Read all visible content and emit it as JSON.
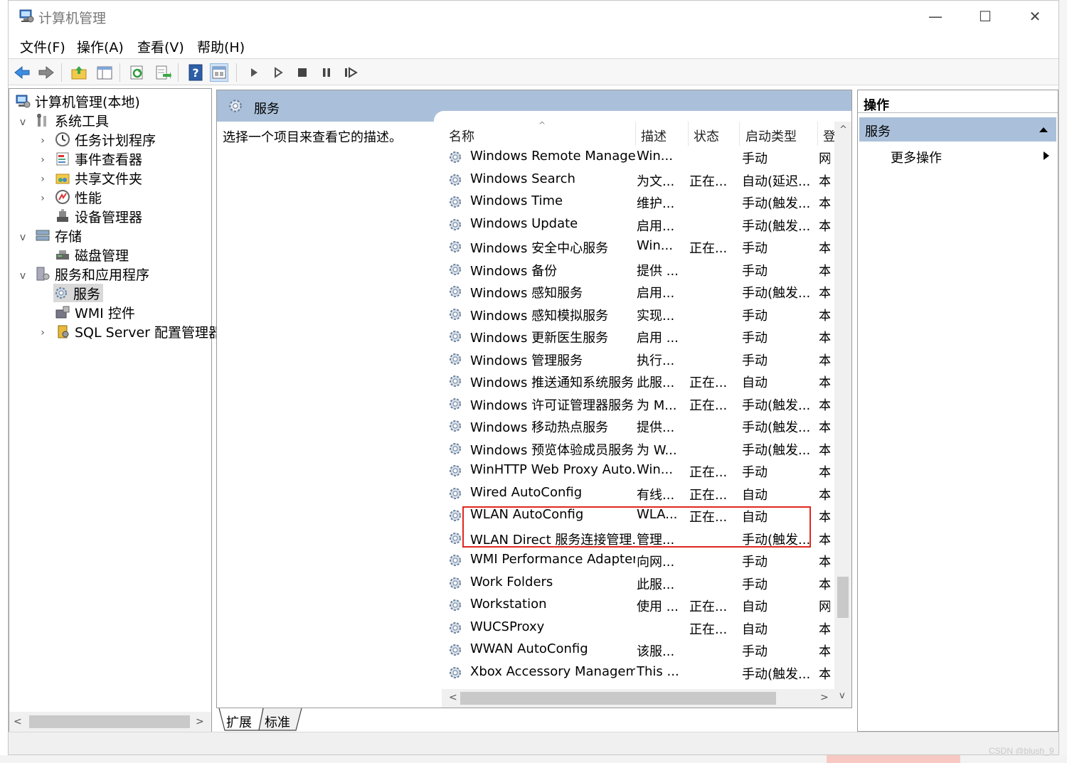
{
  "window": {
    "title": "计算机管理",
    "minimize_glyph": "—",
    "maximize_glyph": "☐",
    "close_glyph": "✕"
  },
  "menu": [
    "文件(F)",
    "操作(A)",
    "查看(V)",
    "帮助(H)"
  ],
  "toolbar_icons": [
    "back-icon",
    "forward-icon",
    "up-folder-icon",
    "show-hide-tree-icon",
    "refresh-icon",
    "export-list-icon",
    "help-icon",
    "properties-icon",
    "start-service-icon",
    "start-service-alt-icon",
    "stop-service-icon",
    "pause-service-icon",
    "resume-service-icon"
  ],
  "tree": [
    {
      "label": "计算机管理(本地)",
      "icon": "computer-management-icon",
      "level": 0,
      "expander": ""
    },
    {
      "label": "系统工具",
      "icon": "system-tools-icon",
      "level": 1,
      "expander": "v"
    },
    {
      "label": "任务计划程序",
      "icon": "clock-icon",
      "level": 2,
      "expander": ">"
    },
    {
      "label": "事件查看器",
      "icon": "event-viewer-icon",
      "level": 2,
      "expander": ">"
    },
    {
      "label": "共享文件夹",
      "icon": "shared-folders-icon",
      "level": 2,
      "expander": ">"
    },
    {
      "label": "性能",
      "icon": "performance-icon",
      "level": 2,
      "expander": ">"
    },
    {
      "label": "设备管理器",
      "icon": "device-manager-icon",
      "level": 2,
      "expander": ""
    },
    {
      "label": "存储",
      "icon": "storage-icon",
      "level": 1,
      "expander": "v"
    },
    {
      "label": "磁盘管理",
      "icon": "disk-management-icon",
      "level": 2,
      "expander": ""
    },
    {
      "label": "服务和应用程序",
      "icon": "services-apps-icon",
      "level": 1,
      "expander": "v"
    },
    {
      "label": "服务",
      "icon": "services-gear-icon",
      "level": 2,
      "expander": "",
      "selected": true
    },
    {
      "label": "WMI 控件",
      "icon": "wmi-control-icon",
      "level": 2,
      "expander": ""
    },
    {
      "label": "SQL Server 配置管理器",
      "icon": "sql-server-config-icon",
      "level": 2,
      "expander": ">"
    }
  ],
  "center": {
    "header_title": "服务",
    "description": "选择一个项目来查看它的描述。"
  },
  "columns": {
    "name": "名称",
    "description": "描述",
    "status": "状态",
    "startup": "启动类型",
    "logon": "登"
  },
  "services": [
    {
      "name": "Windows Remote Manage...",
      "desc": "Win...",
      "status": "",
      "startup": "手动",
      "logon": "网"
    },
    {
      "name": "Windows Search",
      "desc": "为文...",
      "status": "正在...",
      "startup": "自动(延迟...",
      "logon": "本"
    },
    {
      "name": "Windows Time",
      "desc": "维护...",
      "status": "",
      "startup": "手动(触发...",
      "logon": "本"
    },
    {
      "name": "Windows Update",
      "desc": "启用...",
      "status": "",
      "startup": "手动(触发...",
      "logon": "本"
    },
    {
      "name": "Windows 安全中心服务",
      "desc": "Win...",
      "status": "正在...",
      "startup": "手动",
      "logon": "本"
    },
    {
      "name": "Windows 备份",
      "desc": "提供 ...",
      "status": "",
      "startup": "手动",
      "logon": "本"
    },
    {
      "name": "Windows 感知服务",
      "desc": "启用...",
      "status": "",
      "startup": "手动(触发...",
      "logon": "本"
    },
    {
      "name": "Windows 感知模拟服务",
      "desc": "实现...",
      "status": "",
      "startup": "手动",
      "logon": "本"
    },
    {
      "name": "Windows 更新医生服务",
      "desc": "启用 ...",
      "status": "",
      "startup": "手动",
      "logon": "本"
    },
    {
      "name": "Windows 管理服务",
      "desc": "执行...",
      "status": "",
      "startup": "手动",
      "logon": "本"
    },
    {
      "name": "Windows 推送通知系统服务",
      "desc": "此服...",
      "status": "正在...",
      "startup": "自动",
      "logon": "本"
    },
    {
      "name": "Windows 许可证管理器服务",
      "desc": "为 M...",
      "status": "正在...",
      "startup": "手动(触发...",
      "logon": "本"
    },
    {
      "name": "Windows 移动热点服务",
      "desc": "提供...",
      "status": "",
      "startup": "手动(触发...",
      "logon": "本"
    },
    {
      "name": "Windows 预览体验成员服务",
      "desc": "为 W...",
      "status": "",
      "startup": "手动(触发...",
      "logon": "本"
    },
    {
      "name": "WinHTTP Web Proxy Auto...",
      "desc": "Win...",
      "status": "正在...",
      "startup": "手动",
      "logon": "本"
    },
    {
      "name": "Wired AutoConfig",
      "desc": "有线...",
      "status": "正在...",
      "startup": "自动",
      "logon": "本"
    },
    {
      "name": "WLAN AutoConfig",
      "desc": "WLA...",
      "status": "正在...",
      "startup": "自动",
      "logon": "本"
    },
    {
      "name": "WLAN Direct 服务连接管理...",
      "desc": "管理...",
      "status": "",
      "startup": "手动(触发...",
      "logon": "本"
    },
    {
      "name": "WMI Performance Adapter",
      "desc": "向网...",
      "status": "",
      "startup": "手动",
      "logon": "本"
    },
    {
      "name": "Work Folders",
      "desc": "此服...",
      "status": "",
      "startup": "手动",
      "logon": "本"
    },
    {
      "name": "Workstation",
      "desc": "使用 ...",
      "status": "正在...",
      "startup": "自动",
      "logon": "网"
    },
    {
      "name": "WUCSProxy",
      "desc": "",
      "status": "正在...",
      "startup": "自动",
      "logon": "本"
    },
    {
      "name": "WWAN AutoConfig",
      "desc": "该服...",
      "status": "",
      "startup": "手动",
      "logon": "本"
    },
    {
      "name": "Xbox Accessory Managem...",
      "desc": "This ...",
      "status": "",
      "startup": "手动(触发...",
      "logon": "本"
    }
  ],
  "tabs": [
    "扩展",
    "标准"
  ],
  "actions": {
    "title": "操作",
    "section": "服务",
    "more": "更多操作"
  },
  "watermark": "CSDN @blush_9",
  "colors": {
    "header_blue": "#aac0da",
    "highlight_red": "#e0281e",
    "selection_gray": "#d9d9d9",
    "actions_section": "#aac0da"
  }
}
